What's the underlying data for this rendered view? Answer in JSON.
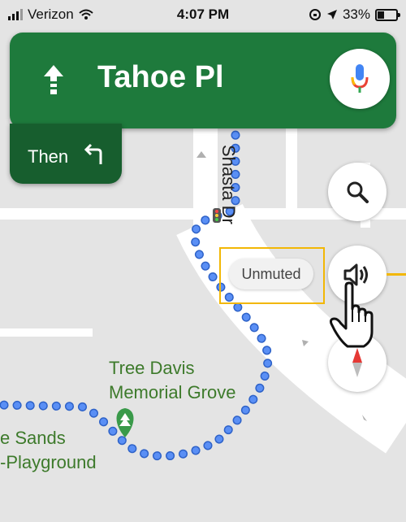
{
  "status_bar": {
    "carrier": "Verizon",
    "time": "4:07 PM",
    "battery": "33%",
    "battery_level": 0.33
  },
  "navigation": {
    "street": "Tahoe Pl",
    "maneuver_icon": "arrow-up-icon",
    "then_label": "Then",
    "then_icon": "turn-left-icon",
    "mic_icon": "mic-icon"
  },
  "map": {
    "street_label": "Shasta Dr",
    "poi_name_line1": "Tree Davis",
    "poi_name_line2": "Memorial Grove",
    "poi2_line1": "e Sands",
    "poi2_line2": "-Playground",
    "route_color": "#4285f4",
    "poi_color": "#3d7a2b"
  },
  "controls": {
    "search_icon": "search-icon",
    "sound_icon": "speaker-icon",
    "compass_icon": "compass-icon",
    "sound_tooltip": "Unmuted"
  },
  "colors": {
    "nav_green": "#1e7a3c",
    "then_green": "#175e2e",
    "highlight": "#f2b705"
  }
}
